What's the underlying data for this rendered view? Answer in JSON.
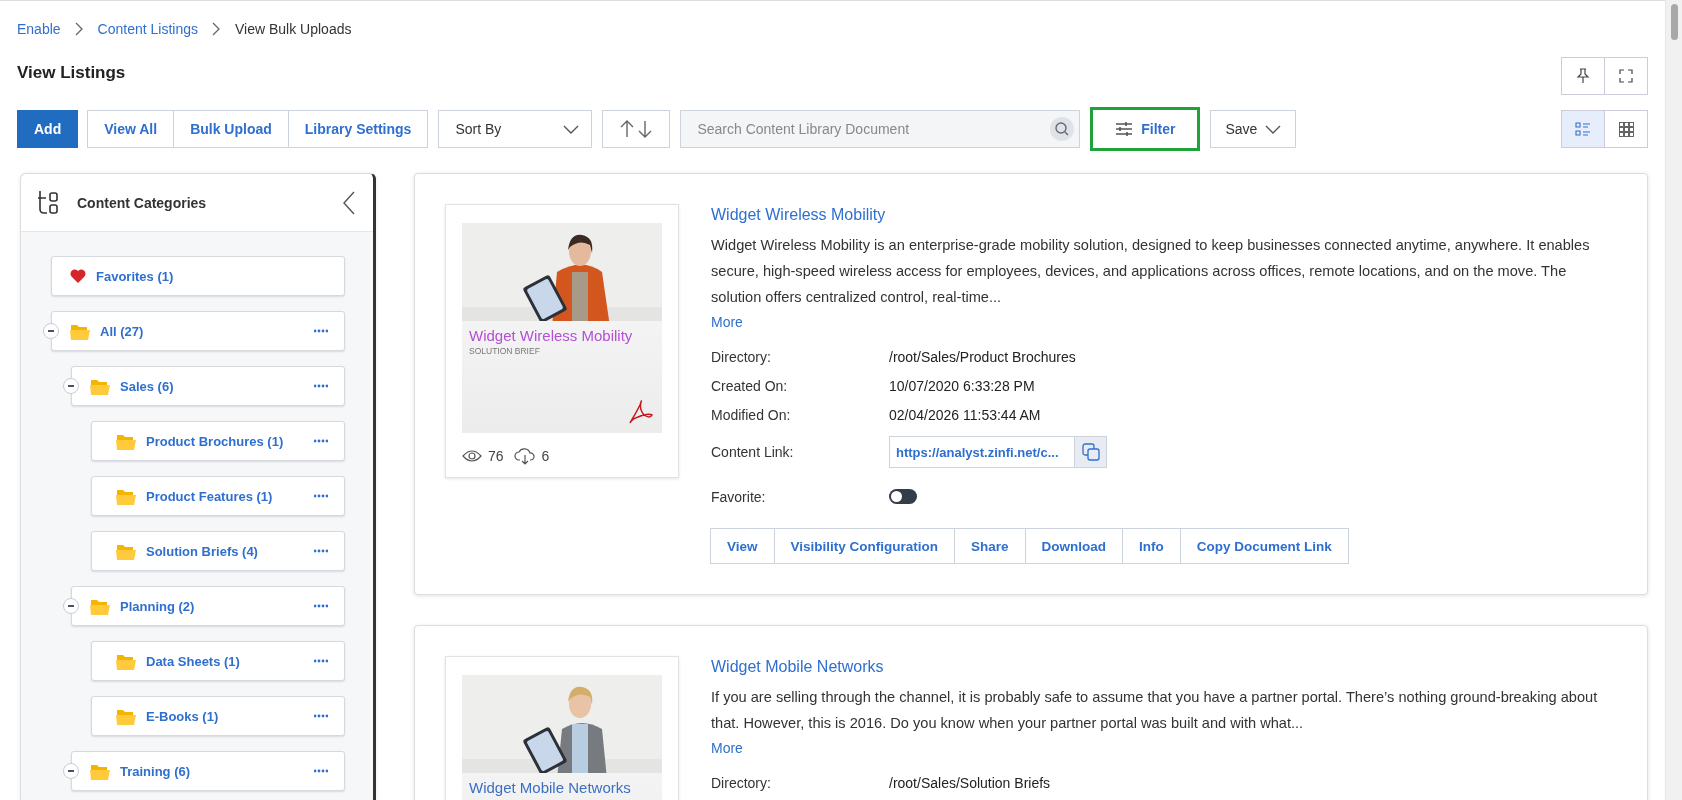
{
  "breadcrumb": [
    {
      "label": "Enable",
      "link": true
    },
    {
      "label": "Content Listings",
      "link": true
    },
    {
      "label": "View Bulk Uploads",
      "link": false
    }
  ],
  "page_title": "View Listings",
  "toolbar": {
    "add": "Add",
    "group": [
      "View All",
      "Bulk Upload",
      "Library Settings"
    ],
    "sort": {
      "placeholder": "Sort By"
    },
    "search": {
      "placeholder": "Search Content Library Document"
    },
    "filter": {
      "label": "Filter",
      "highlighted": true
    },
    "save": "Save",
    "views": [
      {
        "kind": "list",
        "selected": true
      },
      {
        "kind": "grid",
        "selected": false
      }
    ]
  },
  "sidebar": {
    "title": "Content Categories",
    "favorites": "Favorites (1)",
    "tree": [
      {
        "label": "All (27)",
        "expanded": true,
        "children": [
          {
            "label": "Sales (6)",
            "expanded": true,
            "children": [
              {
                "label": "Product Brochures (1)"
              },
              {
                "label": "Product Features (1)"
              },
              {
                "label": "Solution Briefs (4)"
              }
            ]
          },
          {
            "label": "Planning (2)",
            "expanded": true,
            "children": [
              {
                "label": "Data Sheets (1)"
              },
              {
                "label": "E-Books (1)"
              }
            ]
          },
          {
            "label": "Training (6)",
            "expanded": true
          }
        ]
      }
    ]
  },
  "listings": [
    {
      "title": "Widget Wireless Mobility",
      "thumb_title": "Widget Wireless Mobility",
      "thumb_subtitle": "SOLUTION BRIEF",
      "color": "#b44fd6",
      "views": "76",
      "downloads": "6",
      "description": "Widget Wireless Mobility is an enterprise-grade mobility solution, designed to keep businesses connected anytime, anywhere. It enables secure, high-speed wireless access for employees, devices, and applications across offices, remote locations, and on the move. The solution offers centralized control, real-time...",
      "more": "More",
      "details": [
        {
          "kind": "text",
          "label": "Directory:",
          "value": "/root/Sales/Product Brochures"
        },
        {
          "kind": "text",
          "label": "Created On:",
          "value": "10/07/2020 6:33:28 PM"
        },
        {
          "kind": "text",
          "label": "Modified On:",
          "value": "02/04/2026 11:53:44 AM"
        },
        {
          "kind": "link",
          "label": "Content Link:",
          "value": "https://analyst.zinfi.net/c..."
        },
        {
          "kind": "toggle",
          "label": "Favorite:",
          "on": false
        }
      ],
      "actions": [
        "View",
        "Visibility Configuration",
        "Share",
        "Download",
        "Info",
        "Copy Document Link"
      ]
    },
    {
      "title": "Widget Mobile Networks",
      "thumb_title": "Widget Mobile Networks",
      "color": "#3b6fc4",
      "description": "If you are selling through the channel, it is probably safe to assume that you have a partner portal. There’s nothing ground-breaking about that. However, this is 2016. Do you know when your partner portal was built and with what...",
      "more": "More",
      "details": [
        {
          "kind": "text",
          "label": "Directory:",
          "value": "/root/Sales/Solution Briefs"
        }
      ]
    }
  ]
}
